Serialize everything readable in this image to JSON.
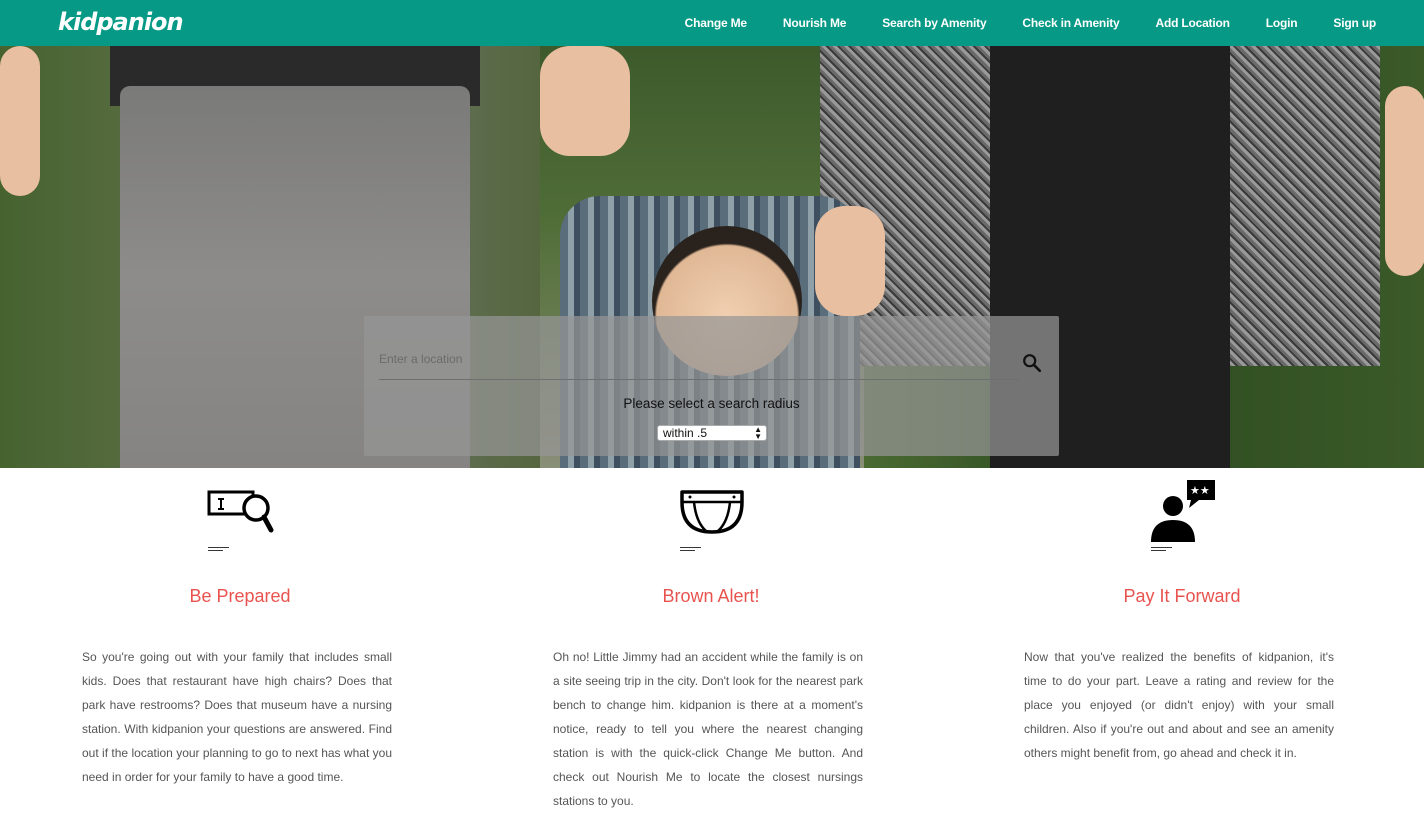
{
  "brand": {
    "logo": "kidpanion"
  },
  "nav": {
    "items": [
      {
        "label": "Change Me"
      },
      {
        "label": "Nourish Me"
      },
      {
        "label": "Search by Amenity"
      },
      {
        "label": "Check in Amenity"
      },
      {
        "label": "Add Location"
      },
      {
        "label": "Login"
      },
      {
        "label": "Sign up"
      }
    ]
  },
  "search": {
    "placeholder": "Enter a location",
    "radius_label": "Please select a search radius",
    "radius_selected": "within .5"
  },
  "features": [
    {
      "title": "Be Prepared",
      "icon": "magnifier-list-icon",
      "text": "So you're going out with your family that includes small kids. Does that restaurant have high chairs? Does that park have restrooms? Does that museum have a nursing station. With kidpanion your questions are answered. Find out if the location your planning to go to next has what you need in order for your family to have a good time."
    },
    {
      "title": "Brown Alert!",
      "icon": "diaper-icon",
      "text": "Oh no! Little Jimmy had an accident while the family is on a site seeing trip in the city. Don't look for the nearest park bench to change him. kidpanion is there at a moment's notice, ready to tell you where the nearest changing station is with the quick-click Change Me button. And check out Nourish Me to locate the closest nursings stations to you."
    },
    {
      "title": "Pay It Forward",
      "icon": "user-review-icon",
      "text": "Now that you've realized the benefits of kidpanion, it's time to do your part. Leave a rating and review for the place you enjoyed (or didn't enjoy) with your small children. Also if you're out and about and see an amenity others might benefit from, go ahead and check it in."
    }
  ],
  "colors": {
    "navbar": "#069986",
    "feature_title": "#e8534f"
  }
}
